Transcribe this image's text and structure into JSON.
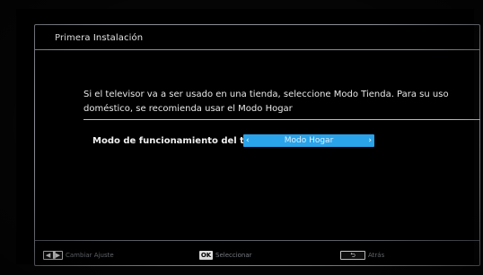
{
  "dialog": {
    "title": "Primera Instalación",
    "description": "Si el televisor va a ser usado en una tienda, seleccione Modo Tienda. Para su uso doméstico, se recomienda usar el Modo Hogar",
    "setting": {
      "label": "Modo de funcionamiento del televisor",
      "value": "Modo Hogar",
      "left_arrow": "‹",
      "right_arrow": "›"
    }
  },
  "footer": {
    "change": {
      "key": "◀▐▶",
      "label": "Cambiar Ajuste"
    },
    "select": {
      "key": "OK",
      "label": "Seleccionar"
    },
    "back": {
      "key": "⮌",
      "label": "Atrás"
    }
  },
  "colors": {
    "accent": "#2aa3ea",
    "background": "#000000",
    "border": "#8a8d96"
  },
  "icons": {
    "change": "left-right-arrows-icon",
    "select": "ok-key-icon",
    "back": "return-arrow-icon"
  }
}
